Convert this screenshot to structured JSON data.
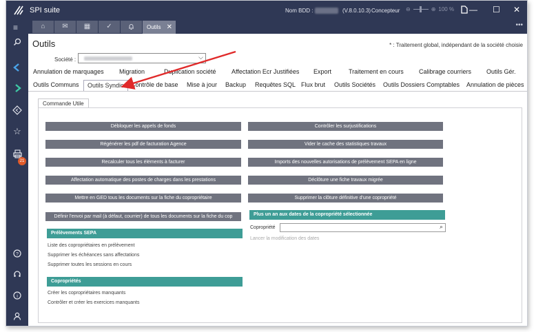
{
  "titlebar": {
    "app_title": "SPI suite",
    "nom_bdd_label": "Nom BDD :",
    "version": "(V.8.0.10.3)",
    "role": "Concepteur",
    "zoom": "100 %",
    "minimize": "—",
    "maximize": "☐",
    "close": "✕"
  },
  "tabbar": {
    "menu_icon": "≡",
    "home_icon": "⌂",
    "mail_icon": "✉",
    "calendar_icon": "▦",
    "check_icon": "✓",
    "bell_icon": "♫",
    "active_tab": "Outils",
    "close_tab": "✕",
    "more": "•••"
  },
  "sidebar": {
    "icons": [
      "search-icon",
      "chevron-left-icon",
      "chevron-right-icon",
      "diamond-icon",
      "star-icon",
      "printer-icon",
      "help-icon",
      "headset-icon",
      "info-icon",
      "user-icon"
    ],
    "badge": "21"
  },
  "page": {
    "title": "Outils",
    "note": "* : Traitement global, indépendant de la société choisie",
    "societe_label": "Société :"
  },
  "tabs_row1": [
    "Annulation de marquages",
    "Migration",
    "Duplication société",
    "Affectation Ecr Justifiées",
    "Export",
    "Traitement en cours",
    "Calibrage courriers",
    "Outils Gér."
  ],
  "tabs_row2": [
    "Outils Communs",
    "Outils Syndic",
    "Contrôle de base",
    "Mise à jour",
    "Backup",
    "Requêtes SQL",
    "Flux brut",
    "Outils Sociétés",
    "Outils Dossiers Comptables",
    "Annulation de pièces"
  ],
  "subtab": "Commande Utile",
  "buttons_left": [
    "Débloquer les appels de fonds",
    "Régénérer les pdf de facturation Agence",
    "Recalculer tous les éléments à facturer",
    "Affectation automatique des postes de charges dans les prestations",
    "Mettre en GED tous les documents sur la fiche du copropriétaire",
    "Définir l'envoi par mail (à défaut, courrier) de tous les documents sur la fiche du cop"
  ],
  "buttons_right": [
    "Contrôler les surjustifications",
    "Vider le cache des statistiques travaux",
    "Imports des nouvelles autorisations de prélèvement SEPA en ligne",
    "Déclôture une fiche travaux migrée",
    "Supprimer la clôture définitive d'une copropriété"
  ],
  "sepa": {
    "title": "Prélèvements SEPA",
    "links": [
      "Liste des copropriétaires en prélèvement",
      "Supprimer les échéances sans affectations",
      "Supprimer toutes les sessions en cours"
    ]
  },
  "copros": {
    "title": "Copropriétés",
    "links": [
      "Créer les copropriétaires manquants",
      "Contrôler et créer les exercices manquants"
    ]
  },
  "dates": {
    "title": "Plus un an aux dates de la copropriété sélectionnée",
    "field_label": "Copropriété",
    "field_value": "",
    "action": "Lancer la modification des dates"
  },
  "colors": {
    "dark": "#2f3855",
    "teal": "#3e9d96",
    "button": "#70737f",
    "arrow": "#e02a2a"
  }
}
